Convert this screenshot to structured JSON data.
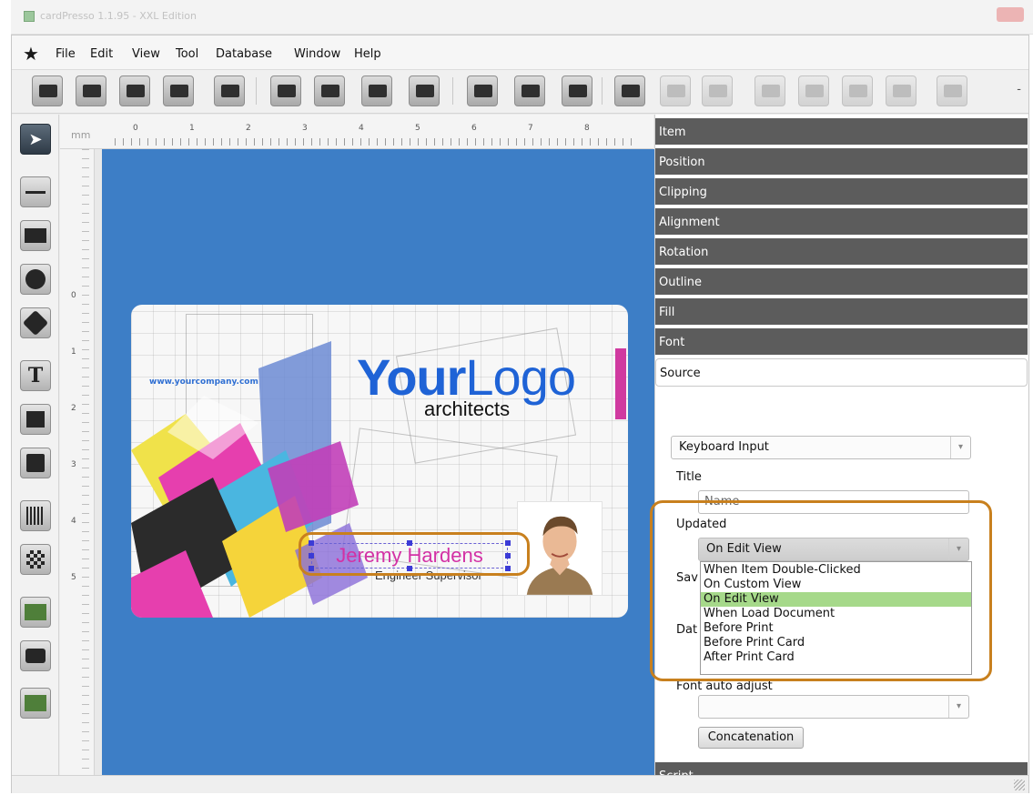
{
  "window": {
    "title": "cardPresso 1.1.95 - XXL Edition"
  },
  "menu": [
    "File",
    "Edit",
    "View",
    "Tool",
    "Database",
    "Window",
    "Help"
  ],
  "toolbar": {
    "groups": [
      [
        "new-card-icon",
        "open-icon",
        "save-icon",
        "card-settings-icon",
        "print-icon"
      ],
      [
        "id-card-icon",
        "layer-icon",
        "database-icon",
        "encode-icon"
      ],
      [
        "zoom-in-icon",
        "zoom-out-icon",
        "zoom-fit-icon"
      ],
      [
        "record-icon",
        "undo-icon",
        "redo-icon",
        "first-record-icon",
        "previous-record-icon",
        "next-record-icon",
        "last-record-icon",
        "refresh-icon"
      ]
    ]
  },
  "ruler": {
    "unit": "mm",
    "h_numbers": [
      "0",
      "1",
      "2",
      "3",
      "4",
      "5",
      "6",
      "7",
      "8"
    ],
    "v_numbers": [
      "0",
      "1",
      "2",
      "3",
      "4",
      "5"
    ]
  },
  "card": {
    "website": "www.yourcompany.com",
    "logo_bold": "Your",
    "logo_thin": "Logo",
    "logo_subtitle": "architects",
    "name": "Jeremy Hardens",
    "role": "Engineer Supervisor",
    "colors": {
      "background": "#3d7ec6",
      "logo": "#1f63d6",
      "name": "#d331a5",
      "annotation": "#c8801e"
    }
  },
  "panel": {
    "sections": [
      "Item",
      "Position",
      "Clipping",
      "Alignment",
      "Rotation",
      "Outline",
      "Fill",
      "Font",
      "Source"
    ],
    "source": {
      "source_type": "Keyboard Input",
      "title_label": "Title",
      "title_value": "Name",
      "updated_label": "Updated",
      "updated_value": "On Edit View",
      "save_label": "Sav",
      "data_label": "Dat",
      "updated_options": [
        "When Item Double-Clicked",
        "On Custom View",
        "On Edit View",
        "When Load Document",
        "Before Print",
        "Before Print Card",
        "After Print Card"
      ],
      "selected_option_index": 2,
      "font_auto_adjust_label": "Font auto adjust",
      "font_auto_adjust_value": "",
      "concatenation_label": "Concatenation"
    },
    "script_label": "Script"
  }
}
